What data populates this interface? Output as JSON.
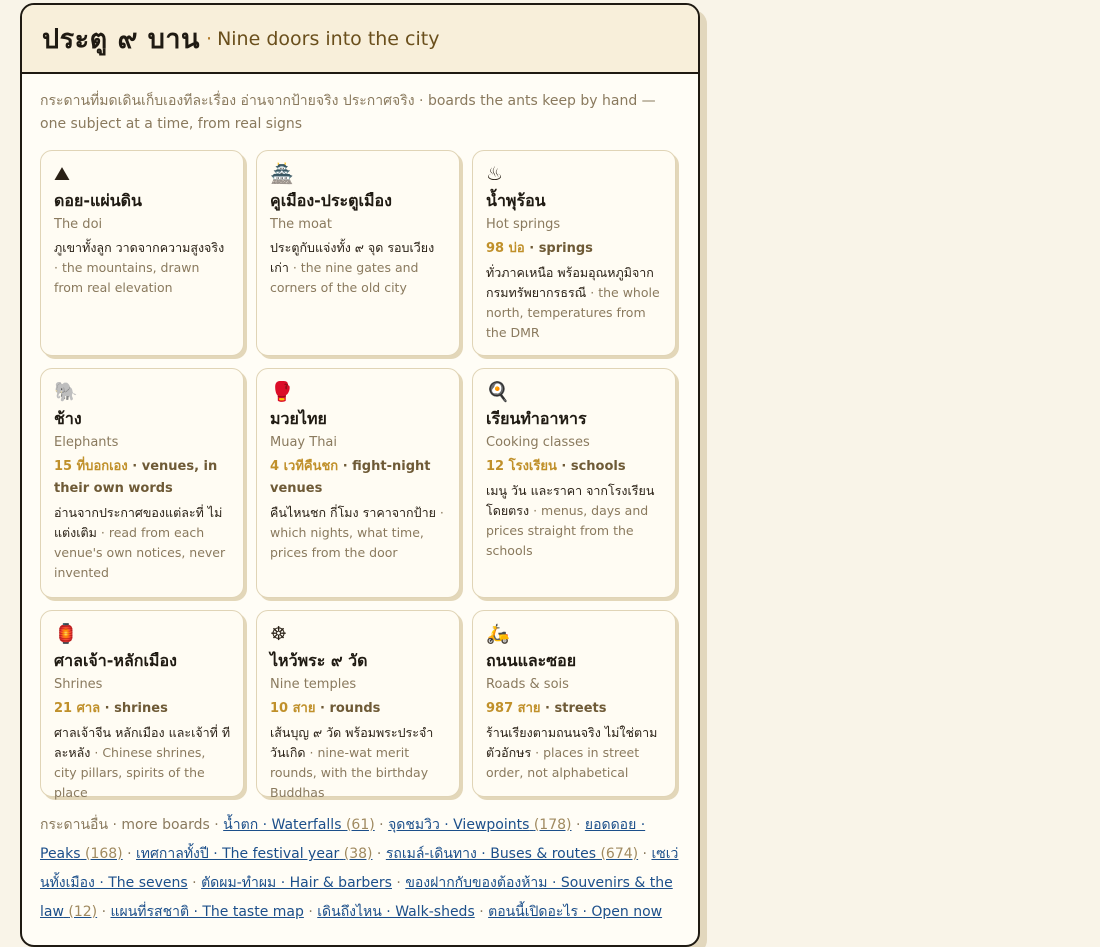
{
  "header": {
    "title_th": "ประตู ๙ บาน",
    "separator": "·",
    "title_en": "Nine doors into the city"
  },
  "intro": {
    "text": "กระดานที่มดเดินเก็บเองทีละเรื่อง อ่านจากป้ายจริง ประกาศจริง · boards the ants keep by hand — one subject at a time, from real signs"
  },
  "cards": [
    {
      "icon_name": "mountain-icon",
      "icon": "⛰",
      "title": "ดอย-แผ่นดิน",
      "subtitle": "The doi",
      "desc_th": "ภูเขาทั้งลูก วาดจากความสูงจริง",
      "sep": " · ",
      "desc_en": "the mountains, drawn from real elevation"
    },
    {
      "icon_name": "castle-icon",
      "icon": "🏯",
      "title": "คูเมือง-ประตูเมือง",
      "subtitle": "The moat",
      "desc_th": "ประตูกับแจ่งทั้ง ๙ จุด รอบเวียงเก่า",
      "sep": " · ",
      "desc_en": "the nine gates and corners of the old city"
    },
    {
      "icon_name": "hot-springs-icon",
      "icon": "♨",
      "title": "น้ำพุร้อน",
      "subtitle": "Hot springs",
      "stat_num": "98 บ่อ",
      "stat_sep": " · ",
      "stat_label": "springs",
      "desc_th": "ทั่วภาคเหนือ พร้อมอุณหภูมิจากกรมทรัพยากรธรณี",
      "sep": " · ",
      "desc_en": "the whole north, temperatures from the DMR"
    },
    {
      "icon_name": "elephant-icon",
      "icon": "🐘",
      "title": "ช้าง",
      "subtitle": "Elephants",
      "stat_num": "15 ที่บอกเอง",
      "stat_sep": " · ",
      "stat_label": "venues, in their own words",
      "desc_th": "อ่านจากประกาศของแต่ละที่ ไม่แต่งเติม",
      "sep": " · ",
      "desc_en": "read from each venue's own notices, never invented"
    },
    {
      "icon_name": "boxing-glove-icon",
      "icon": "🥊",
      "title": "มวยไทย",
      "subtitle": "Muay Thai",
      "stat_num": "4 เวทีคืนชก",
      "stat_sep": " · ",
      "stat_label": "fight-night venues",
      "desc_th": "คืนไหนชก กี่โมง ราคาจากป้าย",
      "sep": " · ",
      "desc_en": "which nights, what time, prices from the door"
    },
    {
      "icon_name": "cooking-icon",
      "icon": "🍳",
      "title": "เรียนทำอาหาร",
      "subtitle": "Cooking classes",
      "stat_num": "12 โรงเรียน",
      "stat_sep": " · ",
      "stat_label": "schools",
      "desc_th": "เมนู วัน และราคา จากโรงเรียนโดยตรง",
      "sep": " · ",
      "desc_en": "menus, days and prices straight from the schools"
    },
    {
      "icon_name": "lantern-icon",
      "icon": "🏮",
      "title": "ศาลเจ้า-หลักเมือง",
      "subtitle": "Shrines",
      "stat_num": "21 ศาล",
      "stat_sep": " · ",
      "stat_label": "shrines",
      "desc_th": "ศาลเจ้าจีน หลักเมือง และเจ้าที่ ทีละหลัง",
      "sep": " · ",
      "desc_en": "Chinese shrines, city pillars, spirits of the place"
    },
    {
      "icon_name": "dharma-wheel-icon",
      "icon": "☸",
      "title": "ไหว้พระ ๙ วัด",
      "subtitle": "Nine temples",
      "stat_num": "10 สาย",
      "stat_sep": " · ",
      "stat_label": "rounds",
      "desc_th": "เส้นบุญ ๙ วัด พร้อมพระประจำวันเกิด",
      "sep": " · ",
      "desc_en": "nine-wat merit rounds, with the birthday Buddhas"
    },
    {
      "icon_name": "scooter-icon",
      "icon": "🛵",
      "title": "ถนนและซอย",
      "subtitle": "Roads & sois",
      "stat_num": "987 สาย",
      "stat_sep": " · ",
      "stat_label": "streets",
      "desc_th": "ร้านเรียงตามถนนจริง ไม่ใช่ตามตัวอักษร",
      "sep": " · ",
      "desc_en": "places in street order, not alphabetical"
    }
  ],
  "more": {
    "label": "กระดานอื่น · more boards",
    "sep": " · ",
    "links": [
      {
        "text": "น้ำตก · Waterfalls",
        "count": "(61)"
      },
      {
        "text": "จุดชมวิว · Viewpoints",
        "count": "(178)"
      },
      {
        "text": "ยอดดอย · Peaks",
        "count": "(168)"
      },
      {
        "text": "เทศกาลทั้งปี · The festival year",
        "count": "(38)"
      },
      {
        "text": "รถเมล์-เดินทาง · Buses & routes",
        "count": "(674)"
      },
      {
        "text": "เซเว่นทั้งเมือง · The sevens",
        "count": ""
      },
      {
        "text": "ตัดผม-ทำผม · Hair & barbers",
        "count": ""
      },
      {
        "text": "ของฝากกับของต้องห้าม · Souvenirs & the law",
        "count": "(12)"
      },
      {
        "text": "แผนที่รสชาติ · The taste map",
        "count": ""
      },
      {
        "text": "เดินถึงไหน · Walk-sheds",
        "count": ""
      },
      {
        "text": "ตอนนี้เปิดอะไร · Open now",
        "count": ""
      }
    ]
  },
  "colors": {
    "accent": "#c0902a",
    "link": "#1c4f8a",
    "muted": "#8a7a5e"
  }
}
